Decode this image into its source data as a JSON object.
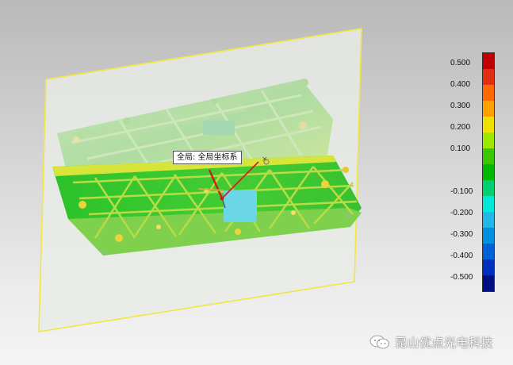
{
  "coordinate_label": "全局: 全局坐标系",
  "watermark": {
    "text": "昆山优点光电科技"
  },
  "legend": {
    "ticks": [
      "0.500",
      "0.400",
      "0.300",
      "0.200",
      "0.100",
      "-0.100",
      "-0.200",
      "-0.300",
      "-0.400",
      "-0.500"
    ],
    "segment_colors": [
      "#c00000",
      "#e03010",
      "#ff6a00",
      "#ffa000",
      "#f0e000",
      "#9ee800",
      "#3cc800",
      "#00b800",
      "#00d070",
      "#00e8d8",
      "#20b8e8",
      "#0090e0",
      "#0060d8",
      "#0030c0",
      "#001080"
    ]
  },
  "colors": {
    "plane_edge": "#f2e640",
    "plane_fill": "#e9ece7",
    "part_green": "#3fc83a",
    "part_yellow": "#d8e63a",
    "axis_red": "#c8201a"
  }
}
